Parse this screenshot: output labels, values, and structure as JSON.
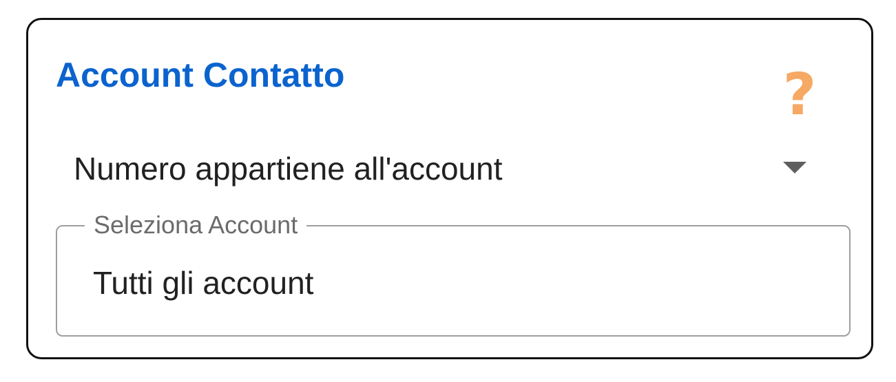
{
  "card": {
    "title": "Account Contatto",
    "help_icon": {
      "glyph": "?",
      "icon": "question-mark-icon",
      "color": "#f5a964"
    },
    "number_select": {
      "selected_value": "Numero appartiene all'account",
      "icon": "chevron-down-icon"
    },
    "account_field": {
      "label": "Seleziona Account",
      "value": "Tutti gli account"
    }
  },
  "colors": {
    "title": "#0b63ce",
    "border": "#111111",
    "field_border": "#9e9e9e",
    "text": "#212121",
    "label": "#6b6b6b"
  }
}
